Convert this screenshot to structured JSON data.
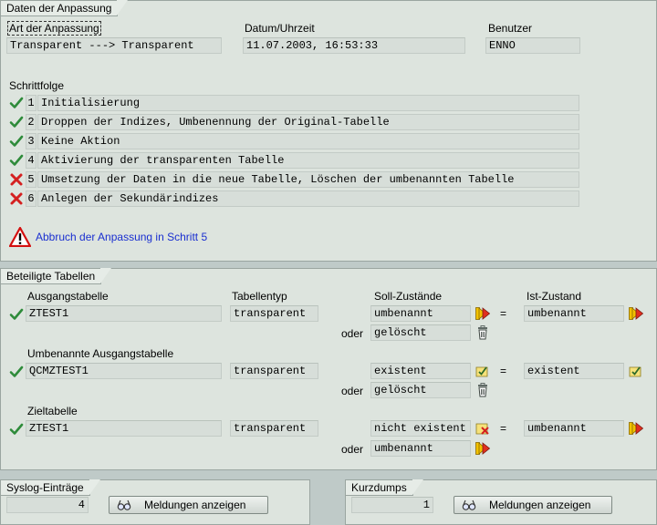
{
  "anpassung": {
    "group_title": "Daten der Anpassung",
    "art_label": "Art der Anpassung",
    "art_value": "Transparent ---> Transparent",
    "datum_label": "Datum/Uhrzeit",
    "datum_value": "11.07.2003, 16:53:33",
    "benutzer_label": "Benutzer",
    "benutzer_value": "ENNO",
    "schrittfolge_label": "Schrittfolge",
    "steps": [
      {
        "num": "1",
        "text": "Initialisierung",
        "status": "ok"
      },
      {
        "num": "2",
        "text": "Droppen der Indizes, Umbenennung der Original-Tabelle",
        "status": "ok"
      },
      {
        "num": "3",
        "text": "Keine Aktion",
        "status": "ok"
      },
      {
        "num": "4",
        "text": "Aktivierung der transparenten Tabelle",
        "status": "ok"
      },
      {
        "num": "5",
        "text": "Umsetzung der Daten in die neue Tabelle, Löschen der umbenannten Tabelle",
        "status": "error"
      },
      {
        "num": "6",
        "text": "Anlegen der Sekundärindizes",
        "status": "error"
      }
    ],
    "warning_text": "Abbruch der Anpassung in Schritt 5"
  },
  "tabellen": {
    "group_title": "Beteiligte Tabellen",
    "col_typ": "Tabellentyp",
    "col_soll": "Soll-Zustände",
    "col_ist": "Ist-Zustand",
    "eq": "=",
    "oder": "oder",
    "rows": [
      {
        "label": "Ausgangstabelle",
        "name": "ZTEST1",
        "typ": "transparent",
        "soll": "umbenannt",
        "soll_alt": "gelöscht",
        "ist": "umbenannt"
      },
      {
        "label": "Umbenannte Ausgangstabelle",
        "name": "QCMZTEST1",
        "typ": "transparent",
        "soll": "existent",
        "soll_alt": "gelöscht",
        "ist": "existent"
      },
      {
        "label": "Zieltabelle",
        "name": "ZTEST1",
        "typ": "transparent",
        "soll": "nicht existent",
        "soll_alt": "umbenannt",
        "ist": "umbenannt"
      }
    ]
  },
  "syslog": {
    "group_title": "Syslog-Einträge",
    "count": "4",
    "button_label": "Meldungen anzeigen"
  },
  "kurzdumps": {
    "group_title": "Kurzdumps",
    "count": "1",
    "button_label": "Meldungen anzeigen"
  },
  "icons": {
    "ok": "green-check-icon",
    "error": "red-cross-icon",
    "warning": "warning-triangle-icon",
    "renamed": "double-arrow-icon",
    "deleted": "trash-icon",
    "exists": "checked-note-icon",
    "not_exists": "crossed-note-icon",
    "messages": "glasses-icon"
  },
  "colors": {
    "background": "#dde4de",
    "field": "#d7ded9",
    "check": "#2e8b3a",
    "cross": "#d42020",
    "warning_text": "#1a2fd0"
  }
}
